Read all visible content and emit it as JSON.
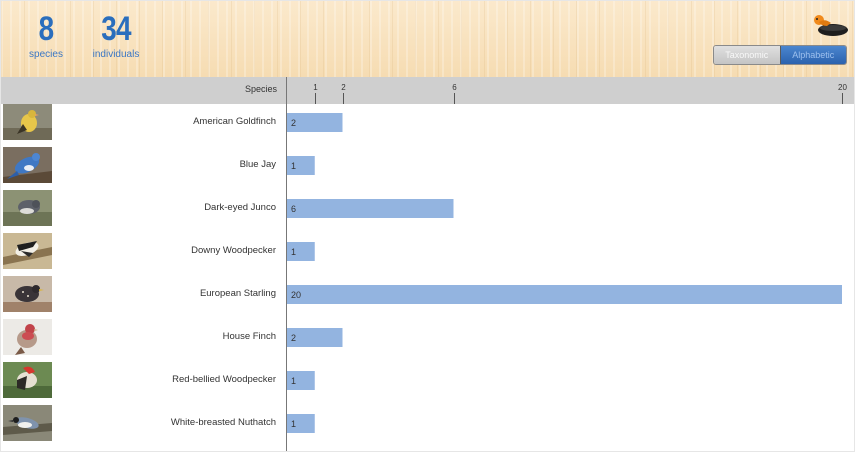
{
  "header": {
    "species_count": "8",
    "species_label": "species",
    "individuals_count": "34",
    "individuals_label": "individuals"
  },
  "sort_toggle": {
    "options": [
      "Taxonomic",
      "Alphabetic"
    ],
    "selected": "Alphabetic"
  },
  "table": {
    "species_header": "Species"
  },
  "colors": {
    "bar": "#93b4e0",
    "accent": "#2a6ebd",
    "header_bg": "#cfcfcf"
  },
  "chart_data": {
    "type": "bar",
    "orientation": "horizontal",
    "categories": [
      "American Goldfinch",
      "Blue Jay",
      "Dark-eyed Junco",
      "Downy Woodpecker",
      "European Starling",
      "House Finch",
      "Red-bellied Woodpecker",
      "White-breasted Nuthatch"
    ],
    "values": [
      2,
      1,
      6,
      1,
      20,
      2,
      1,
      1
    ],
    "xticks": [
      1,
      2,
      6,
      20
    ],
    "xlim": [
      0,
      20
    ],
    "ylabel": "Species",
    "data_labels": true
  }
}
